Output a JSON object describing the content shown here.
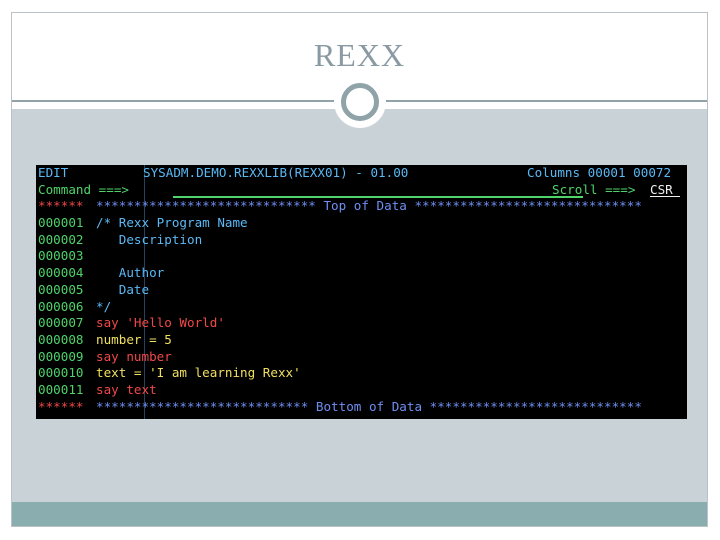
{
  "slide": {
    "title": "REXX"
  },
  "terminal": {
    "header": {
      "mode": "EDIT",
      "dataset": "SYSADM.DEMO.REXXLIB(REXX01) - 01.00",
      "columns": "Columns 00001 00072"
    },
    "command": {
      "label": "Command ===>",
      "value": "",
      "scroll_label": "Scroll ===>",
      "scroll_value": "CSR"
    },
    "top_marker": {
      "prefix": "******",
      "text": "***************************** Top of Data ******************************"
    },
    "bottom_marker": {
      "prefix": "******",
      "text": "**************************** Bottom of Data ****************************"
    },
    "lines": [
      {
        "num": "000001",
        "text": "/* Rexx Program Name"
      },
      {
        "num": "000002",
        "text": "   Description"
      },
      {
        "num": "000003",
        "text": ""
      },
      {
        "num": "000004",
        "text": "   Author"
      },
      {
        "num": "000005",
        "text": "   Date"
      },
      {
        "num": "000006",
        "text": "*/"
      },
      {
        "num": "000007",
        "text": "say 'Hello World'"
      },
      {
        "num": "000008",
        "text": "number = 5"
      },
      {
        "num": "000009",
        "text": "say number"
      },
      {
        "num": "000010",
        "text": "text = 'I am learning Rexx'"
      },
      {
        "num": "000011",
        "text": "say text"
      }
    ],
    "line_colors": [
      "cyan",
      "cyan",
      "cyan",
      "cyan",
      "cyan",
      "cyan",
      "red",
      "yellow",
      "red",
      "yellow",
      "red"
    ]
  },
  "colors": {
    "terminal_bg": "#000000",
    "ispf_green": "#4fd36a",
    "ispf_cyan": "#5ab9f5",
    "ispf_blue": "#6f8ff2",
    "ispf_red": "#f04848",
    "ispf_yellow": "#f0e060",
    "slide_body": "#c9d2d7",
    "footer": "#8aaeb0"
  }
}
